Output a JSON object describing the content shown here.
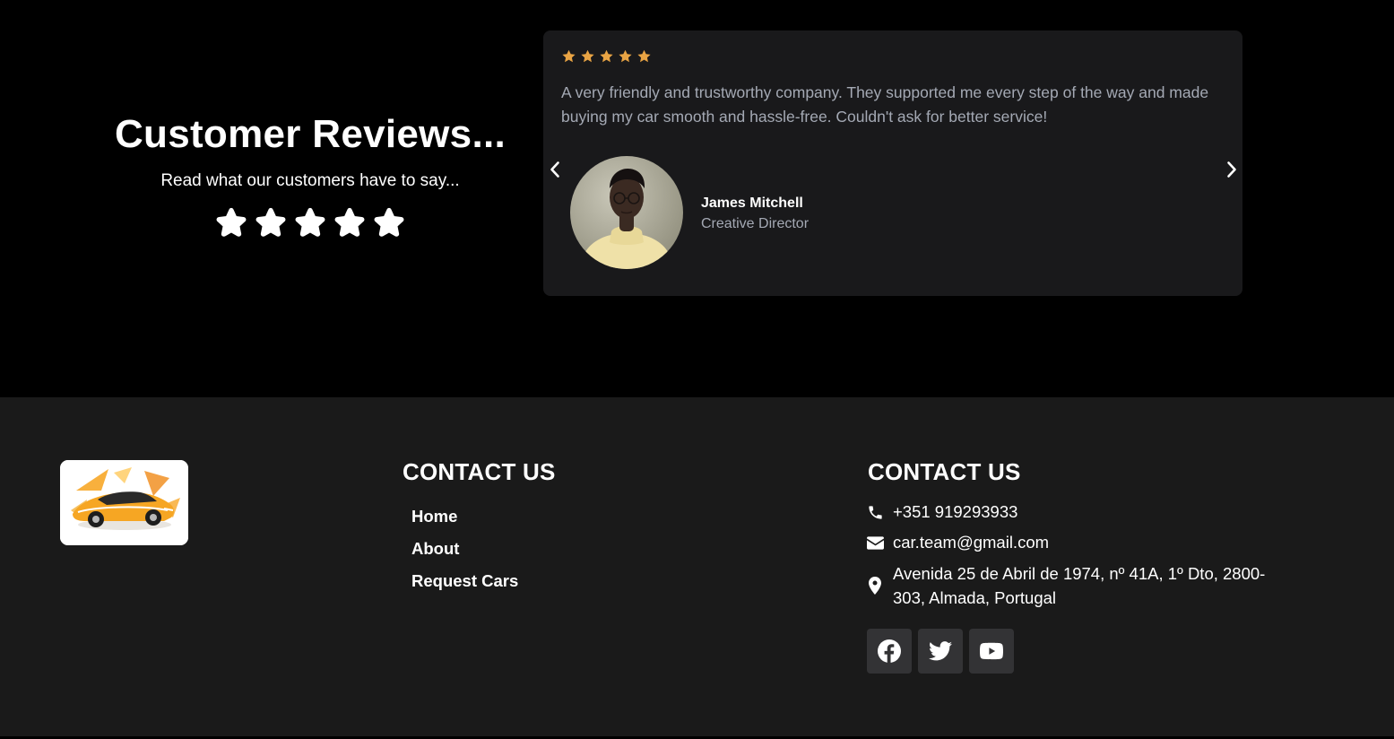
{
  "reviews": {
    "title": "Customer Reviews...",
    "subtitle": "Read what our customers have to say...",
    "rating": 5,
    "star_color": "#ffffff"
  },
  "review_card": {
    "rating": 5,
    "star_color": "#e9a444",
    "text": "A very friendly and trustworthy company. They supported me every step of the way and made buying my car smooth and hassle-free. Couldn't ask for better service!",
    "reviewer_name": "James Mitchell",
    "reviewer_role": "Creative Director",
    "prev_icon": "chevron-left-icon",
    "next_icon": "chevron-right-icon"
  },
  "footer": {
    "logo_icon": "sports-car-logo",
    "links_heading": "CONTACT US",
    "links": [
      {
        "label": "Home"
      },
      {
        "label": "About"
      },
      {
        "label": "Request Cars"
      }
    ],
    "contact_heading": "CONTACT US",
    "phone": "+351 919293933",
    "email": "car.team@gmail.com",
    "address": "Avenida 25 de Abril de 1974, nº 41A, 1º Dto, 2800-303, Almada, Portugal",
    "social": [
      {
        "name": "facebook-icon"
      },
      {
        "name": "twitter-icon"
      },
      {
        "name": "youtube-icon"
      }
    ],
    "background": "#1a1a1a",
    "social_button_bg": "#333335"
  }
}
